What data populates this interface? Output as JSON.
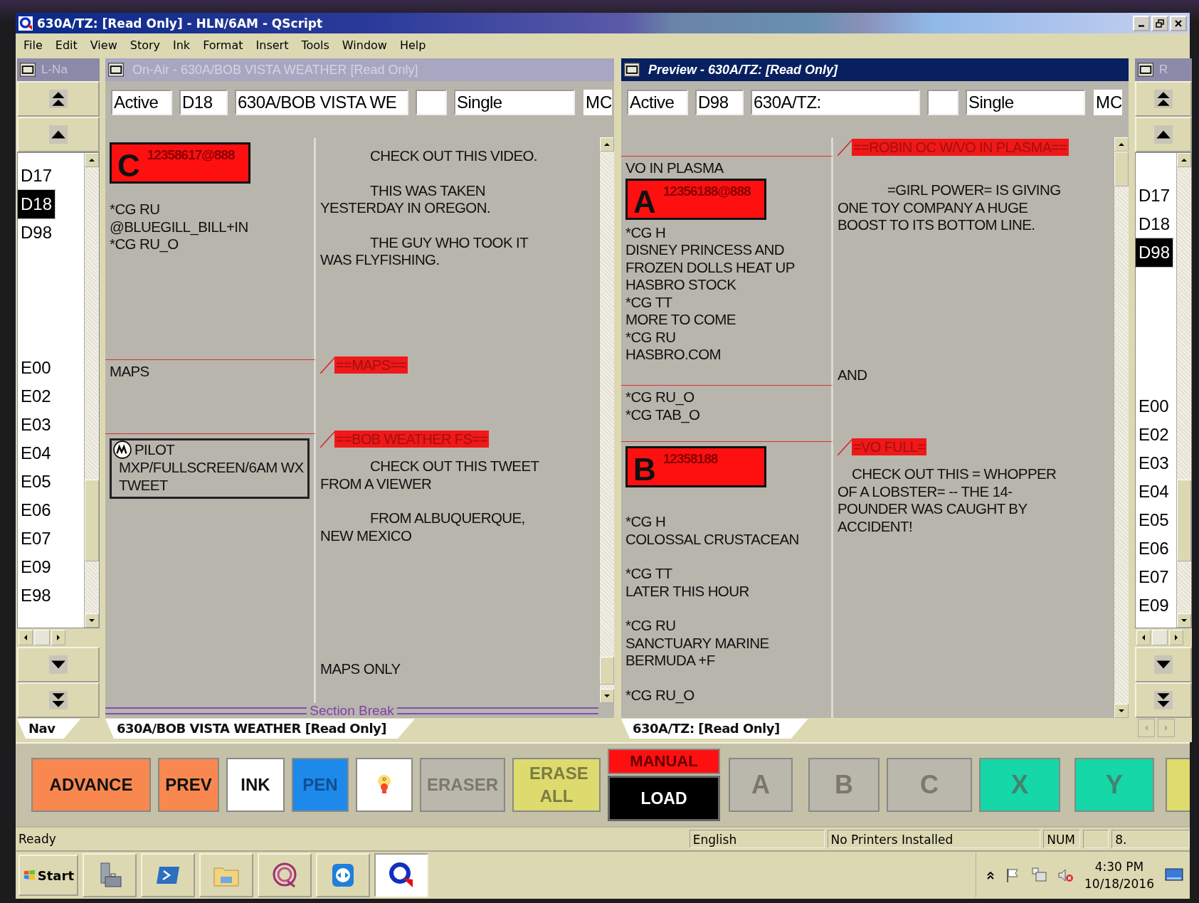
{
  "window": {
    "title": "630A/TZ: [Read Only] - HLN/6AM - QScript"
  },
  "menu": [
    "File",
    "Edit",
    "View",
    "Story",
    "Ink",
    "Format",
    "Insert",
    "Tools",
    "Window",
    "Help"
  ],
  "left_nav": {
    "title": "L-Na",
    "tab": "Nav",
    "groups": [
      [
        {
          "label": "D17",
          "selected": false
        },
        {
          "label": "D18",
          "selected": true
        },
        {
          "label": "D98",
          "selected": false
        }
      ],
      [
        {
          "label": "E00",
          "selected": false
        },
        {
          "label": "E02",
          "selected": false
        },
        {
          "label": "E03",
          "selected": false
        },
        {
          "label": "E04",
          "selected": false
        },
        {
          "label": "E05",
          "selected": false
        },
        {
          "label": "E06",
          "selected": false
        },
        {
          "label": "E07",
          "selected": false
        },
        {
          "label": "E09",
          "selected": false
        },
        {
          "label": "E98",
          "selected": false
        }
      ]
    ]
  },
  "panes": [
    {
      "title": "On-Air - 630A/BOB VISTA WEATHER [Read Only]",
      "active": false,
      "fields": [
        {
          "kind": "text",
          "value": "Active"
        },
        {
          "kind": "text",
          "value": "D18"
        },
        {
          "kind": "text",
          "value": "630A/BOB VISTA WE"
        },
        {
          "kind": "blank"
        },
        {
          "kind": "text",
          "value": "Single"
        }
      ],
      "mode": "MC",
      "segments": [
        {
          "left": [
            {
              "kind": "cue",
              "letter": "C",
              "number": "12358617@888"
            },
            {
              "kind": "lines",
              "lines": [
                "*CG RU",
                "@BLUEGILL_BILL+IN",
                "*CG RU_O"
              ]
            }
          ],
          "right": [
            {
              "kind": "indented",
              "lines": [
                "CHECK OUT THIS VIDEO."
              ]
            },
            {
              "kind": "indented",
              "lines": [
                "THIS WAS TAKEN",
                "YESTERDAY IN OREGON."
              ]
            },
            {
              "kind": "indented",
              "lines": [
                "THE GUY WHO TOOK IT",
                "WAS FLYFISHING."
              ]
            }
          ]
        },
        {
          "label": "==MAPS==",
          "left": [
            {
              "kind": "lines",
              "lines": [
                "MAPS"
              ]
            }
          ]
        },
        {
          "label": "==BOB WEATHER FS==",
          "left": [
            {
              "kind": "box",
              "title": "PILOT",
              "lines": [
                "MXP/FULLSCREEN/6AM WX",
                "TWEET"
              ]
            }
          ],
          "right": [
            {
              "kind": "indented",
              "lines": [
                "CHECK OUT THIS TWEET",
                "FROM A VIEWER"
              ]
            },
            {
              "kind": "indented",
              "lines": [
                "FROM ALBUQUERQUE,",
                "NEW MEXICO"
              ]
            },
            {
              "kind": "footer",
              "lines": [
                "MAPS ONLY"
              ]
            }
          ]
        }
      ],
      "section_break": "Section Break",
      "tab": "630A/BOB VISTA WEATHER [Read Only]"
    },
    {
      "title": "Preview - 630A/TZ: [Read Only]",
      "active": true,
      "fields": [
        {
          "kind": "text",
          "value": "Active"
        },
        {
          "kind": "text",
          "value": "D98"
        },
        {
          "kind": "text",
          "value": "630A/TZ:"
        },
        {
          "kind": "blank"
        },
        {
          "kind": "text",
          "value": "Single"
        }
      ],
      "mode": "MC",
      "segments": [
        {
          "label": "==ROBIN OC W/VO IN PLASMA=="
        },
        {
          "left": [
            {
              "kind": "lines",
              "lines": [
                "VO IN PLASMA"
              ]
            },
            {
              "kind": "cue",
              "letter": "A",
              "number": "12356188@888"
            },
            {
              "kind": "lines",
              "lines": [
                "*CG H",
                "DISNEY PRINCESS AND",
                "FROZEN DOLLS HEAT UP",
                "HASBRO STOCK",
                "*CG TT",
                "MORE TO COME",
                "*CG RU",
                "HASBRO.COM"
              ]
            }
          ],
          "right": [
            {
              "kind": "indented",
              "lines": [
                "=GIRL POWER= IS GIVING",
                "ONE TOY COMPANY A HUGE",
                "BOOST TO ITS BOTTOM LINE."
              ]
            },
            {
              "kind": "footer",
              "lines": [
                "AND"
              ]
            }
          ]
        },
        {
          "left": [
            {
              "kind": "lines",
              "lines": [
                "*CG RU_O",
                "*CG TAB_O"
              ]
            }
          ]
        },
        {
          "label": "=VO FULL=",
          "left": [
            {
              "kind": "cue",
              "letter": "B",
              "number": "12358188"
            },
            {
              "kind": "lines",
              "lines": [
                "*CG H",
                "COLOSSAL CRUSTACEAN"
              ]
            },
            {
              "kind": "lines",
              "lines": [
                "*CG TT",
                "LATER THIS HOUR"
              ]
            },
            {
              "kind": "lines",
              "lines": [
                "*CG RU",
                "SANCTUARY MARINE",
                "BERMUDA +F"
              ]
            },
            {
              "kind": "lines",
              "lines": [
                "*CG RU_O"
              ]
            }
          ],
          "right": [
            {
              "kind": "short",
              "lines": [
                "CHECK OUT THIS = WHOPPER",
                "OF A LOBSTER= -- THE 14-",
                "POUNDER WAS CAUGHT BY",
                "ACCIDENT!"
              ]
            }
          ]
        }
      ],
      "tab": "630A/TZ: [Read Only]"
    }
  ],
  "right_nav": {
    "title": "R",
    "groups": [
      [
        {
          "label": "D17",
          "selected": false
        },
        {
          "label": "D18",
          "selected": false
        },
        {
          "label": "D98",
          "selected": true
        }
      ],
      [
        {
          "label": "E00",
          "selected": false
        },
        {
          "label": "E02",
          "selected": false
        },
        {
          "label": "E03",
          "selected": false
        },
        {
          "label": "E04",
          "selected": false
        },
        {
          "label": "E05",
          "selected": false
        },
        {
          "label": "E06",
          "selected": false
        },
        {
          "label": "E07",
          "selected": false
        },
        {
          "label": "E09",
          "selected": false
        }
      ]
    ]
  },
  "toolbar": [
    {
      "kind": "orange",
      "label": "ADVANCE",
      "disabled": false
    },
    {
      "kind": "orange",
      "label": "PREV",
      "disabled": false
    },
    {
      "kind": "white",
      "label": "INK",
      "disabled": false
    },
    {
      "kind": "blue",
      "label": "PEN",
      "disabled": true
    },
    {
      "kind": "bulb"
    },
    {
      "kind": "gray",
      "label": "ERASER",
      "disabled": true
    },
    {
      "kind": "yellow",
      "label": "ERASE ALL",
      "disabled": true
    },
    {
      "kind": "pair",
      "top": "MANUAL",
      "bottom": "LOAD"
    },
    {
      "kind": "gray",
      "label": "A",
      "disabled": true
    },
    {
      "kind": "gray",
      "label": "B",
      "disabled": true
    },
    {
      "kind": "gray",
      "label": "C",
      "disabled": true
    },
    {
      "kind": "teal",
      "label": "X",
      "disabled": true
    },
    {
      "kind": "teal",
      "label": "Y",
      "disabled": true
    },
    {
      "kind": "yellow"
    }
  ],
  "status_bar": {
    "message": "Ready",
    "language": "English",
    "printer": "No Printers Installed",
    "num": "NUM",
    "zoom": "8."
  },
  "taskbar": {
    "start": "Start",
    "apps": [
      {
        "kind": "server",
        "selected": false
      },
      {
        "kind": "terminal",
        "selected": false
      },
      {
        "kind": "folder",
        "selected": false
      },
      {
        "kind": "ring",
        "selected": false
      },
      {
        "kind": "remote",
        "selected": false
      },
      {
        "kind": "qlogo",
        "selected": true
      }
    ],
    "time": "4:30 PM",
    "date": "10/18/2016"
  }
}
